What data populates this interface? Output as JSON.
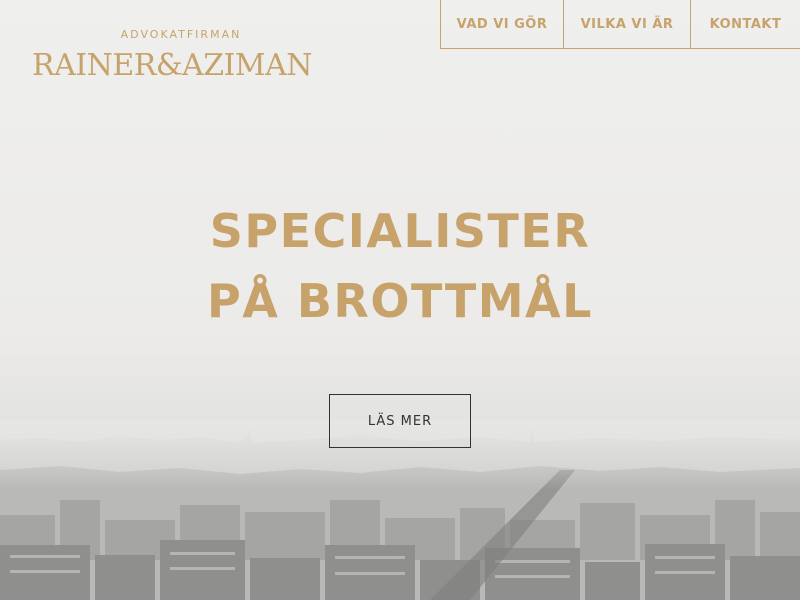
{
  "brand": {
    "subtitle": "ADVOKATFIRMAN",
    "name": "RAINER&AZIMAN"
  },
  "nav": {
    "items": [
      {
        "label": "VAD VI GÖR"
      },
      {
        "label": "VILKA VI ÄR"
      },
      {
        "label": "KONTAKT"
      }
    ]
  },
  "hero": {
    "headline_line1": "SPECIALISTER",
    "headline_line2": "PÅ BROTTMÅL",
    "cta_label": "LÄS MER"
  },
  "colors": {
    "accent": "#c7a36b",
    "text_dark": "#333333",
    "background": "#eeeeec"
  }
}
